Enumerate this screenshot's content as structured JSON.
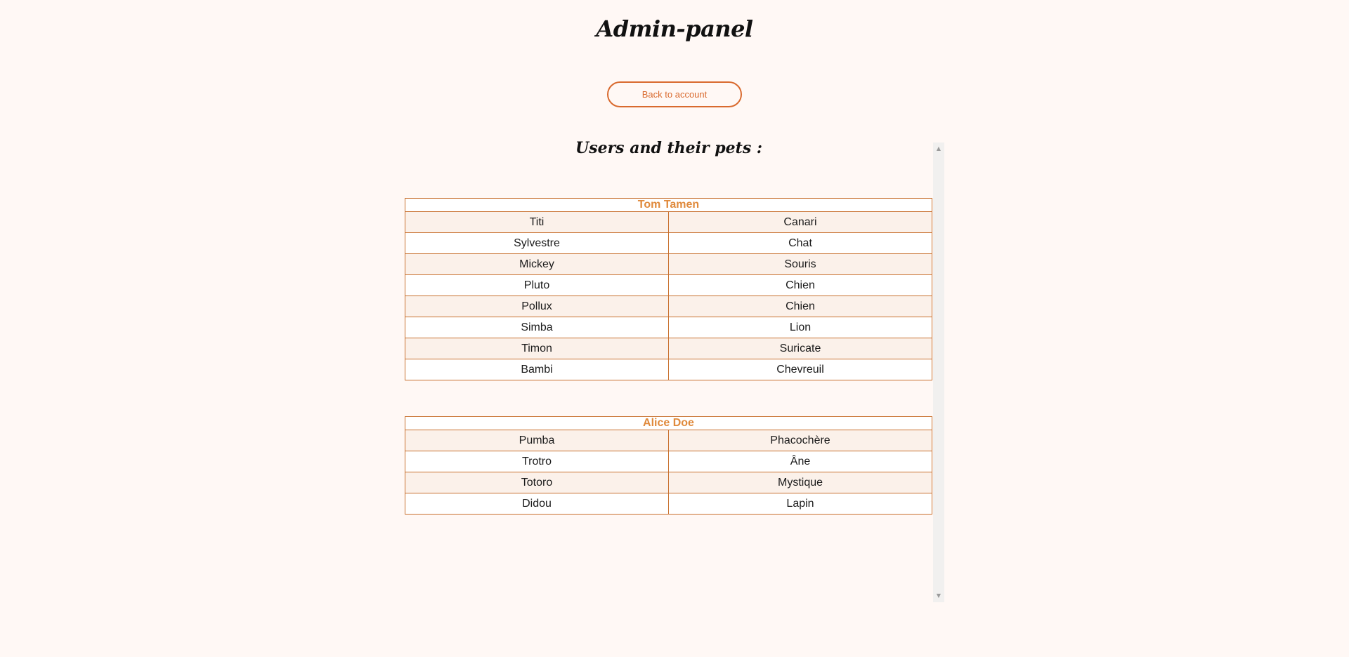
{
  "header": {
    "title": "Admin-panel",
    "back_label": "Back to account"
  },
  "main": {
    "section_title": "Users and their pets :",
    "owners": [
      {
        "name": "Tom Tamen",
        "pets": [
          {
            "name": "Titi",
            "species": "Canari"
          },
          {
            "name": "Sylvestre",
            "species": "Chat"
          },
          {
            "name": "Mickey",
            "species": "Souris"
          },
          {
            "name": "Pluto",
            "species": "Chien"
          },
          {
            "name": "Pollux",
            "species": "Chien"
          },
          {
            "name": "Simba",
            "species": "Lion"
          },
          {
            "name": "Timon",
            "species": "Suricate"
          },
          {
            "name": "Bambi",
            "species": "Chevreuil"
          }
        ]
      },
      {
        "name": "Alice Doe",
        "pets": [
          {
            "name": "Pumba",
            "species": "Phacochère"
          },
          {
            "name": "Trotro",
            "species": "Âne"
          },
          {
            "name": "Totoro",
            "species": "Mystique"
          },
          {
            "name": "Didou",
            "species": "Lapin"
          }
        ]
      }
    ]
  },
  "scrollbar": {
    "up_icon": "arrow-up-icon",
    "down_icon": "arrow-down-icon"
  },
  "colors": {
    "accent": "#d96a2e",
    "owner_name": "#e08a3c",
    "background": "#fff8f5",
    "row_alt": "#fbf1ea"
  }
}
